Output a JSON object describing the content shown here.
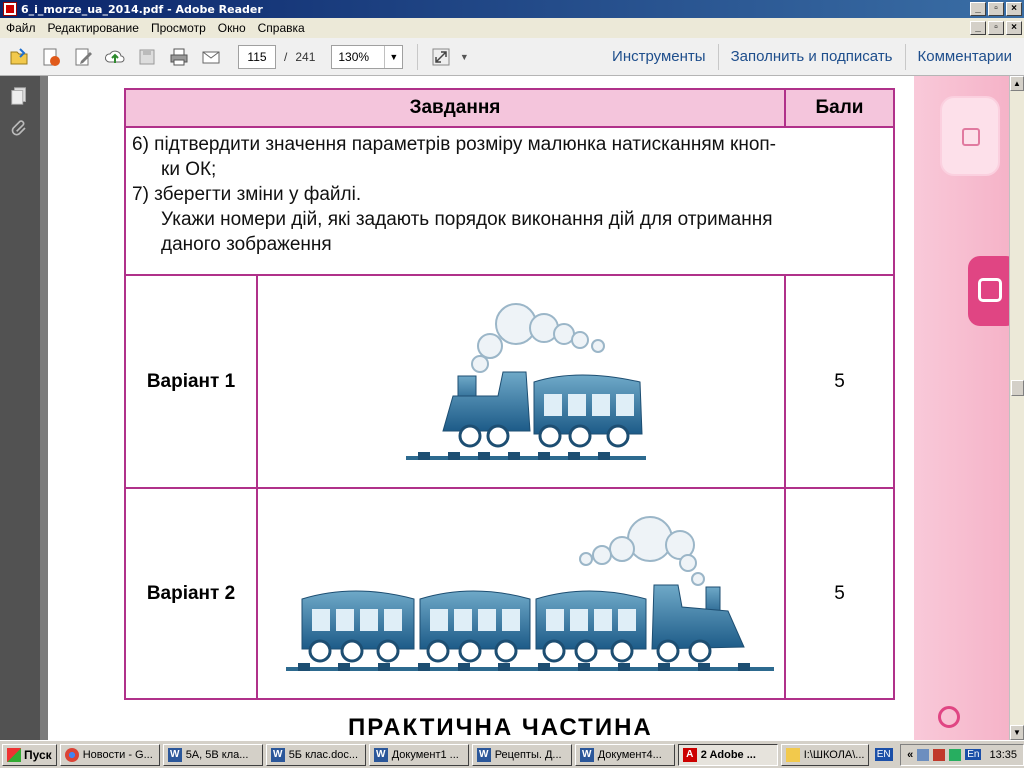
{
  "window": {
    "title": "6_i_morze_ua_2014.pdf - Adobe Reader",
    "controls": [
      "_",
      "▫",
      "×"
    ]
  },
  "menu": [
    "Файл",
    "Редактирование",
    "Просмотр",
    "Окно",
    "Справка"
  ],
  "toolbar": {
    "page_current": "115",
    "page_sep": "/",
    "page_total": "241",
    "zoom": "130%",
    "tools_label": "Инструменты",
    "fill_sign_label": "Заполнить и подписать",
    "comments_label": "Комментарии"
  },
  "document": {
    "header_task": "Завдання",
    "header_points": "Бали",
    "task_lines": [
      "6)  підтвердити значення параметрів розміру малюнка натисканням кноп-",
      "ки ОК;",
      "7)  зберегти зміни у файлі.",
      "Укажи номери дій, які задають порядок виконання дій для отримання",
      "даного зображення"
    ],
    "rows": [
      {
        "variant": "Варіант 1",
        "points": "5"
      },
      {
        "variant": "Варіант 2",
        "points": "5"
      }
    ],
    "cut_heading": "ПРАКТИЧНА ЧАСТИНА"
  },
  "taskbar": {
    "start": "Пуск",
    "buttons": [
      {
        "label": "Новости - G...",
        "icon": "chrome-icon"
      },
      {
        "label": "5А, 5В  кла...",
        "icon": "word-icon"
      },
      {
        "label": "5Б клас.doc...",
        "icon": "word-icon"
      },
      {
        "label": "Документ1 ...",
        "icon": "word-icon"
      },
      {
        "label": "Рецепты. Д...",
        "icon": "word-icon"
      },
      {
        "label": "Документ4...",
        "icon": "word-icon"
      },
      {
        "label": "2 Adobe ...",
        "icon": "adobe-icon"
      },
      {
        "label": "I:\\ШКОЛА\\...",
        "icon": "folder-icon"
      }
    ],
    "lang": "EN",
    "tray_lang": "En",
    "clock": "13:35",
    "chevron": "«"
  }
}
